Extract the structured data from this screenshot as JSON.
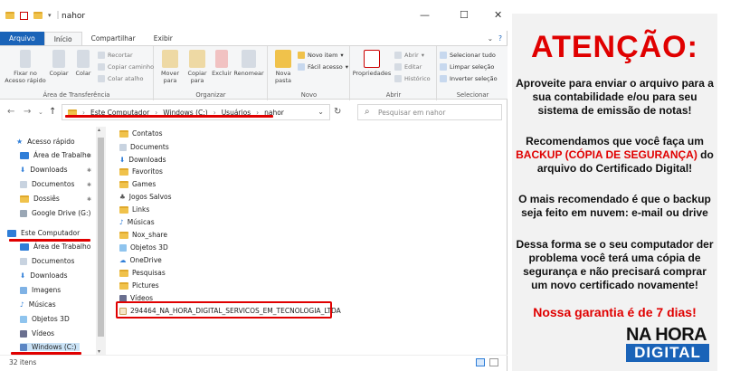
{
  "window": {
    "title": "nahor",
    "minimize": "—",
    "maximize": "☐",
    "close": "✕"
  },
  "ribbon_tabs": [
    "Arquivo",
    "Início",
    "Compartilhar",
    "Exibir"
  ],
  "ribbon": {
    "clipboard": {
      "pin": "Fixar no Acesso rápido",
      "copy": "Copiar",
      "paste": "Colar",
      "cut": "Recortar",
      "copy_path": "Copiar caminho",
      "paste_shortcut": "Colar atalho",
      "label": "Área de Transferência"
    },
    "organize": {
      "move": "Mover para",
      "copy_to": "Copiar para",
      "delete": "Excluir",
      "rename": "Renomear",
      "label": "Organizar"
    },
    "new": {
      "new_folder": "Nova pasta",
      "new_item": "Novo item",
      "easy_access": "Fácil acesso",
      "label": "Novo"
    },
    "open": {
      "properties": "Propriedades",
      "open": "Abrir",
      "edit": "Editar",
      "history": "Histórico",
      "label": "Abrir"
    },
    "select": {
      "select_all": "Selecionar tudo",
      "clear": "Limpar seleção",
      "invert": "Inverter seleção",
      "label": "Selecionar"
    }
  },
  "address": {
    "crumbs": [
      "Este Computador",
      "Windows (C:)",
      "Usuários",
      "nahor"
    ],
    "search_placeholder": "Pesquisar em nahor"
  },
  "sidebar": {
    "quick_access": "Acesso rápido",
    "quick_items": [
      "Área de Trabalho",
      "Downloads",
      "Documentos",
      "Dossiês",
      "Google Drive (G:)"
    ],
    "this_pc": "Este Computador",
    "pc_items": [
      "Área de Trabalho",
      "Documentos",
      "Downloads",
      "Imagens",
      "Músicas",
      "Objetos 3D",
      "Vídeos",
      "Windows (C:)"
    ]
  },
  "files": [
    "Contatos",
    "Documents",
    "Downloads",
    "Favoritos",
    "Games",
    "Jogos Salvos",
    "Links",
    "Músicas",
    "Nox_share",
    "Objetos 3D",
    "OneDrive",
    "Pesquisas",
    "Pictures",
    "Vídeos",
    "294464_NA_HORA_DIGITAL_SERVICOS_EM_TECNOLOGIA_LTDA"
  ],
  "status": {
    "count": "32 itens"
  },
  "panel": {
    "title": "ATENÇÃO:",
    "p1": "Aproveite para enviar o arquivo para a sua contabilidade e/ou para seu sistema de emissão de notas!",
    "p2_a": "Recomendamos que você faça um",
    "p2_b": "BACKUP (CÓPIA DE SEGURANÇA)",
    "p2_c": "do arquivo do Certificado Digital!",
    "p3": "O mais recomendado é que o backup seja feito em nuvem: e-mail ou drive",
    "p4": "Dessa forma se o seu computador der problema você terá uma cópia de segurança e não precisará comprar um novo certificado novamente!",
    "guarantee": "Nossa garantia é de 7 dias!",
    "logo_top": "NA HORA",
    "logo_bottom": "DIGITAL"
  },
  "colors": {
    "accent_red": "#e00000",
    "ribbon_blue": "#1a63b8"
  }
}
